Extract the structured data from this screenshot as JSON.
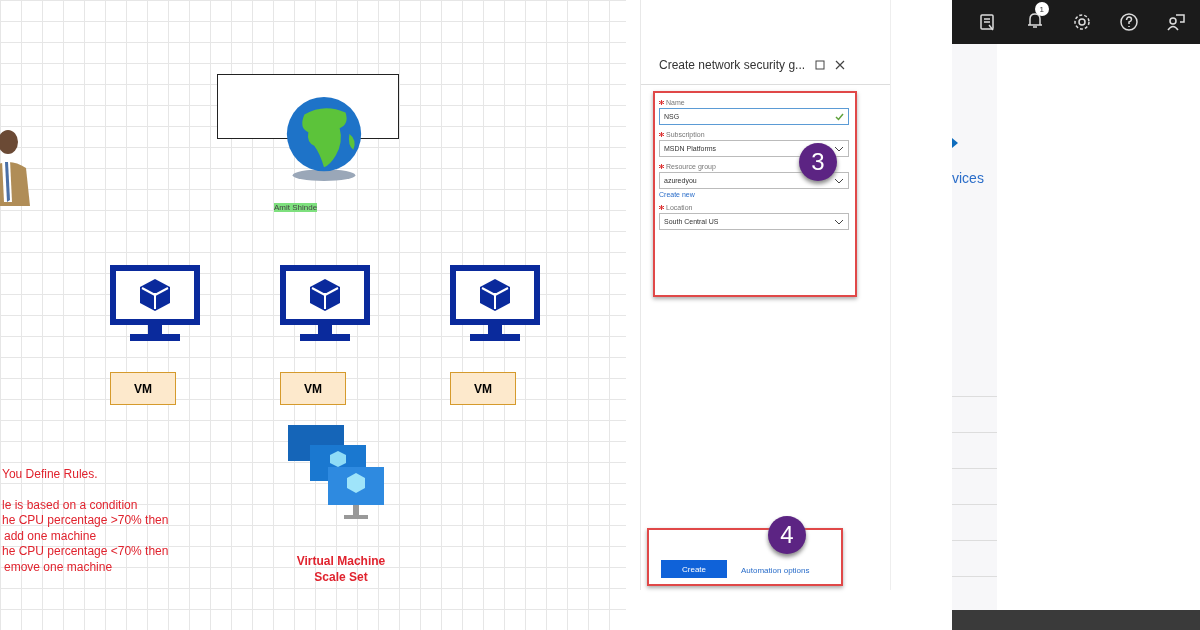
{
  "diagram": {
    "globe_label": "Amit Shinde",
    "vms": [
      {
        "label": "VM"
      },
      {
        "label": "VM"
      },
      {
        "label": "VM"
      }
    ],
    "scale_set_label": "Virtual Machine Scale Set",
    "rules_title": "You Define Rules.",
    "rules_lines": [
      "le is based on a condition",
      "he CPU percentage >70% then",
      "add one machine",
      "he CPU percentage <70% then",
      "emove one machine"
    ]
  },
  "panel": {
    "title": "Create network security g...",
    "fields": [
      {
        "kind": "text",
        "label": "Name",
        "value": "NSG",
        "required": true,
        "valid": true
      },
      {
        "kind": "select",
        "label": "Subscription",
        "value": "MSDN Platforms",
        "required": true
      },
      {
        "kind": "select",
        "label": "Resource group",
        "value": "azuredyou",
        "required": true,
        "link": "Create new"
      },
      {
        "kind": "select",
        "label": "Location",
        "value": "South Central US",
        "required": true
      }
    ],
    "callouts": [
      "3",
      "4"
    ],
    "create_button": "Create",
    "automation_link": "Automation options"
  },
  "portal": {
    "notification_count": "1",
    "link": "vices"
  }
}
